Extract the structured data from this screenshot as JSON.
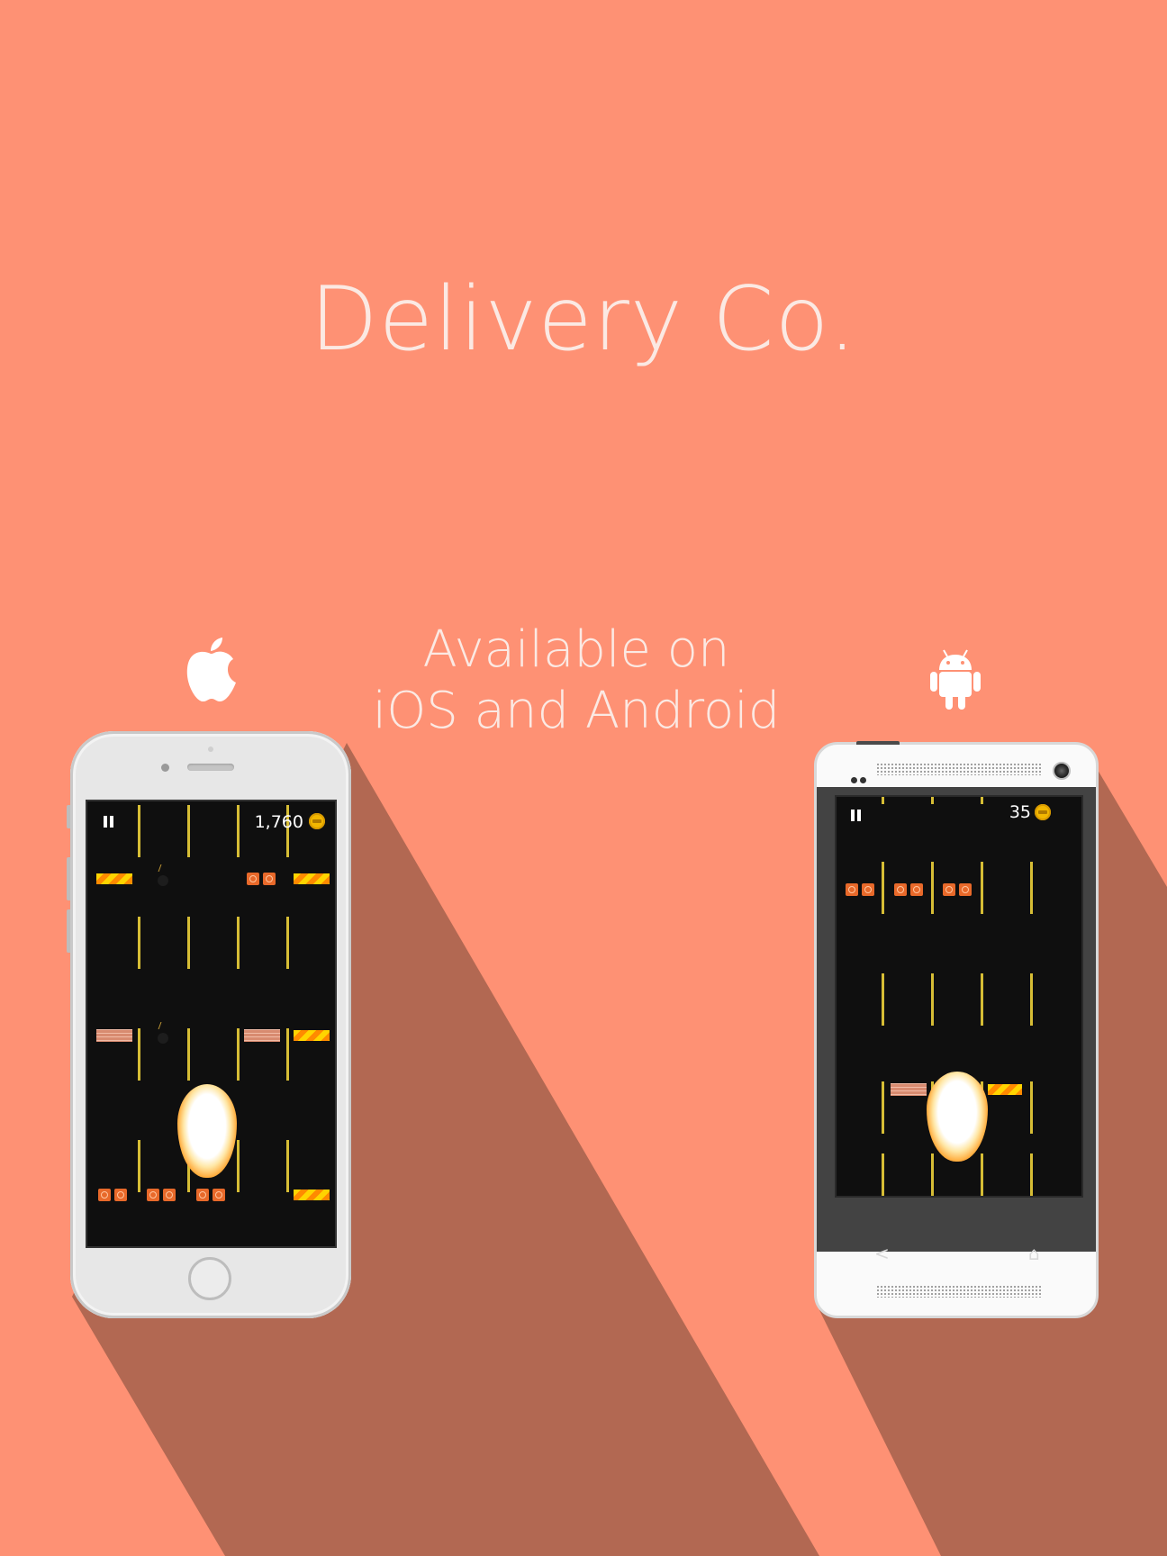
{
  "title": "Delivery Co.",
  "tagline": {
    "line1": "Available on",
    "line2": "iOS and Android"
  },
  "platforms": {
    "ios": {
      "icon": "apple-icon"
    },
    "android": {
      "icon": "android-icon"
    }
  },
  "iphone": {
    "screen": {
      "score": "1,760",
      "score_icon": "coin-icon",
      "pause_icon": "pause-icon"
    }
  },
  "android_phone": {
    "screen": {
      "score": "35",
      "score_icon": "coin-icon",
      "pause_icon": "pause-icon"
    },
    "nav": {
      "back": "<",
      "home": "⌂"
    }
  },
  "colors": {
    "background": "#fe9174",
    "shadow": "#b26852",
    "text": "#fbe9e3"
  }
}
